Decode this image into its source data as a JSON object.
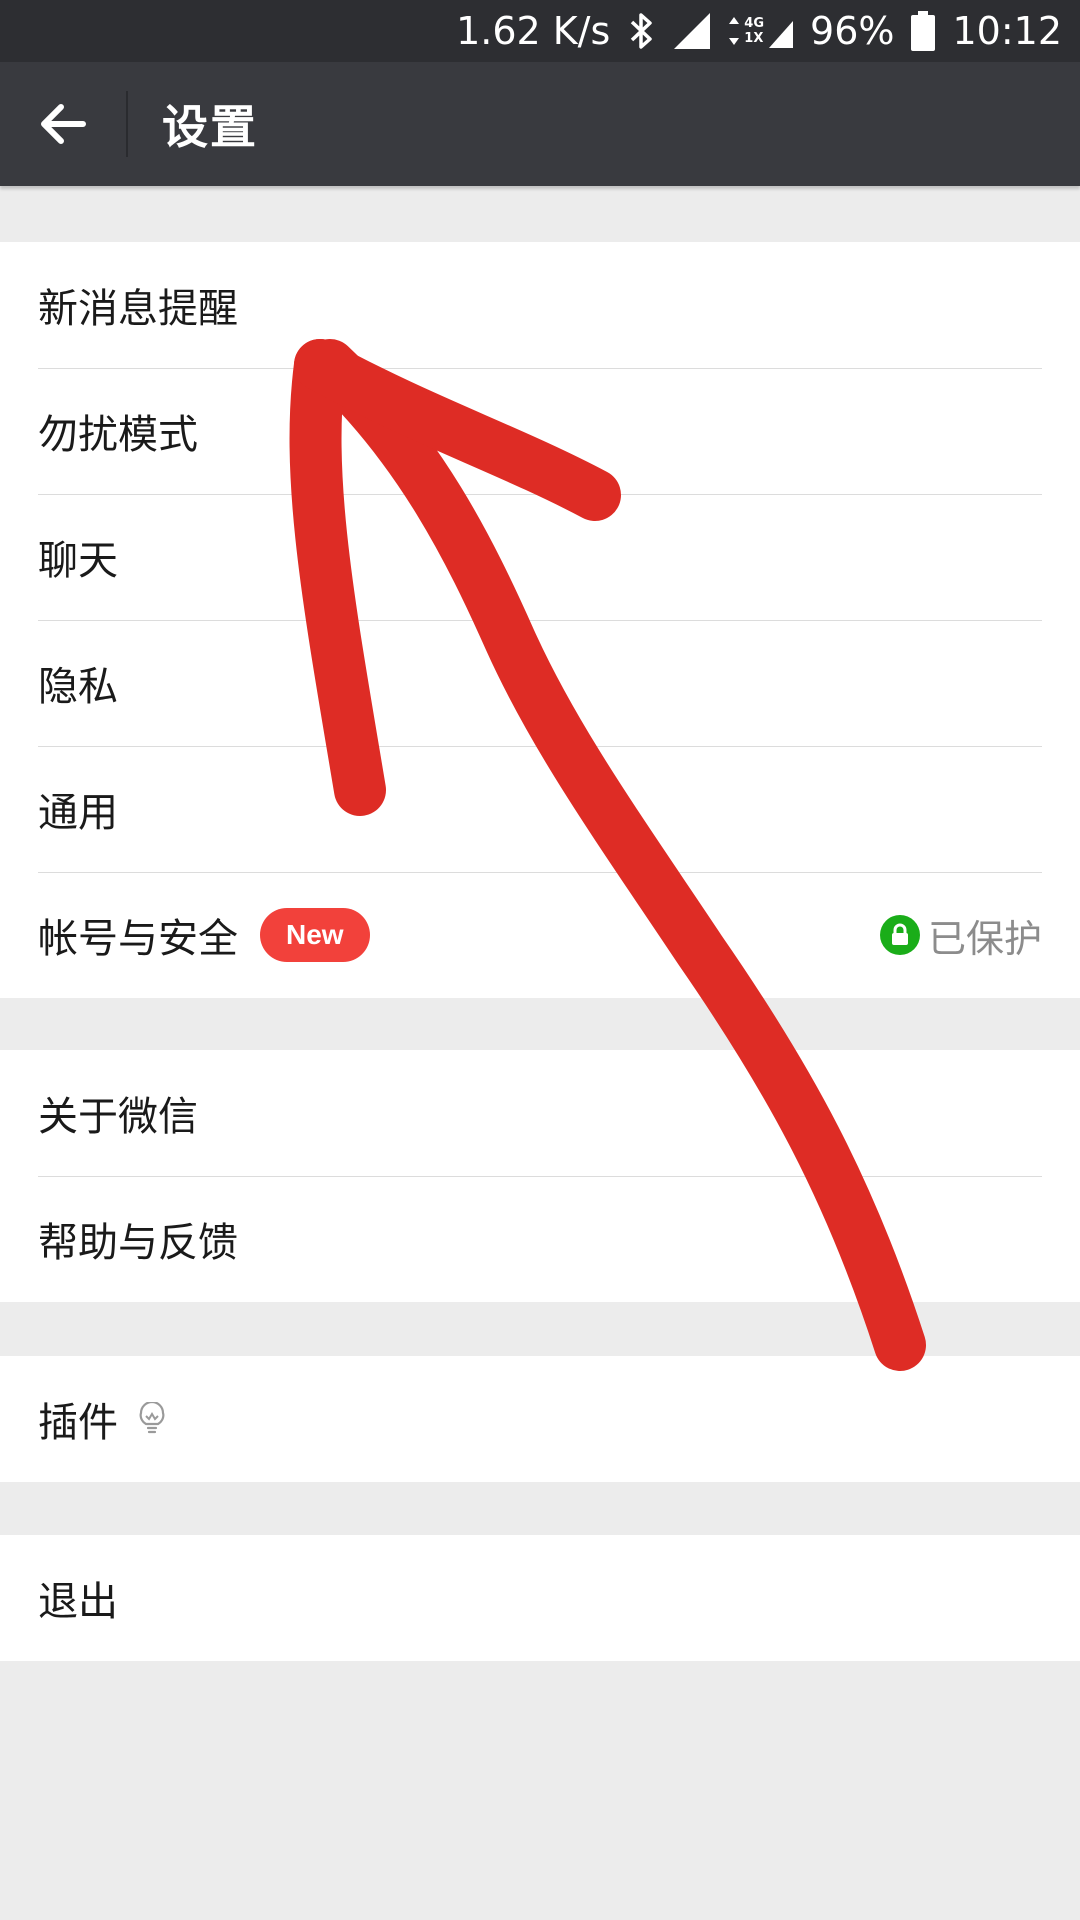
{
  "status_bar": {
    "network_speed": "1.62 K/s",
    "battery": "96%",
    "time": "10:12",
    "network_type_top": "4G",
    "network_type_bottom": "1X",
    "icons": [
      "bluetooth-icon",
      "signal-icon",
      "data-signal-icon",
      "battery-icon"
    ]
  },
  "toolbar": {
    "back_icon": "arrow-left-icon",
    "title": "设置"
  },
  "groups": {
    "main": {
      "items": [
        {
          "label": "新消息提醒"
        },
        {
          "label": "勿扰模式"
        },
        {
          "label": "聊天"
        },
        {
          "label": "隐私"
        },
        {
          "label": "通用"
        },
        {
          "label": "帐号与安全",
          "badge": "New",
          "status": "已保护",
          "status_icon": "lock-icon"
        }
      ]
    },
    "about": {
      "items": [
        {
          "label": "关于微信"
        },
        {
          "label": "帮助与反馈"
        }
      ]
    },
    "plugins": {
      "items": [
        {
          "label": "插件",
          "icon": "lightbulb-icon"
        }
      ]
    },
    "logout": {
      "items": [
        {
          "label": "退出"
        }
      ]
    }
  },
  "colors": {
    "status_bar_bg": "#2d2e32",
    "toolbar_bg": "#393a3f",
    "page_bg": "#ececec",
    "badge_red": "#f2413b",
    "protected_green": "#1aad19",
    "annotation_red": "#de2c25"
  }
}
